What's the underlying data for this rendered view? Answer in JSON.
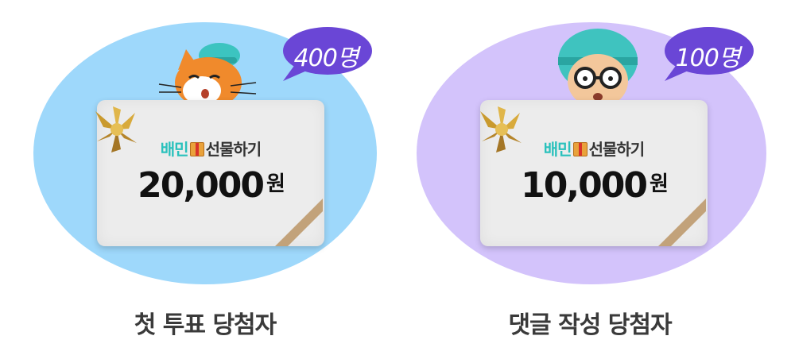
{
  "prizes": [
    {
      "winner_count": "400명",
      "brand_a": "배민",
      "brand_b": "선물하기",
      "amount": "20,000",
      "currency": "원",
      "caption": "첫 투표 당첨자",
      "blob_color": "#9ed8fb",
      "bubble_color": "#6a46d6",
      "character_icon": "cat-icon"
    },
    {
      "winner_count": "100명",
      "brand_a": "배민",
      "brand_b": "선물하기",
      "amount": "10,000",
      "currency": "원",
      "caption": "댓글 작성 당첨자",
      "blob_color": "#d3c3fb",
      "bubble_color": "#6a46d6",
      "character_icon": "glasses-character-icon"
    }
  ]
}
